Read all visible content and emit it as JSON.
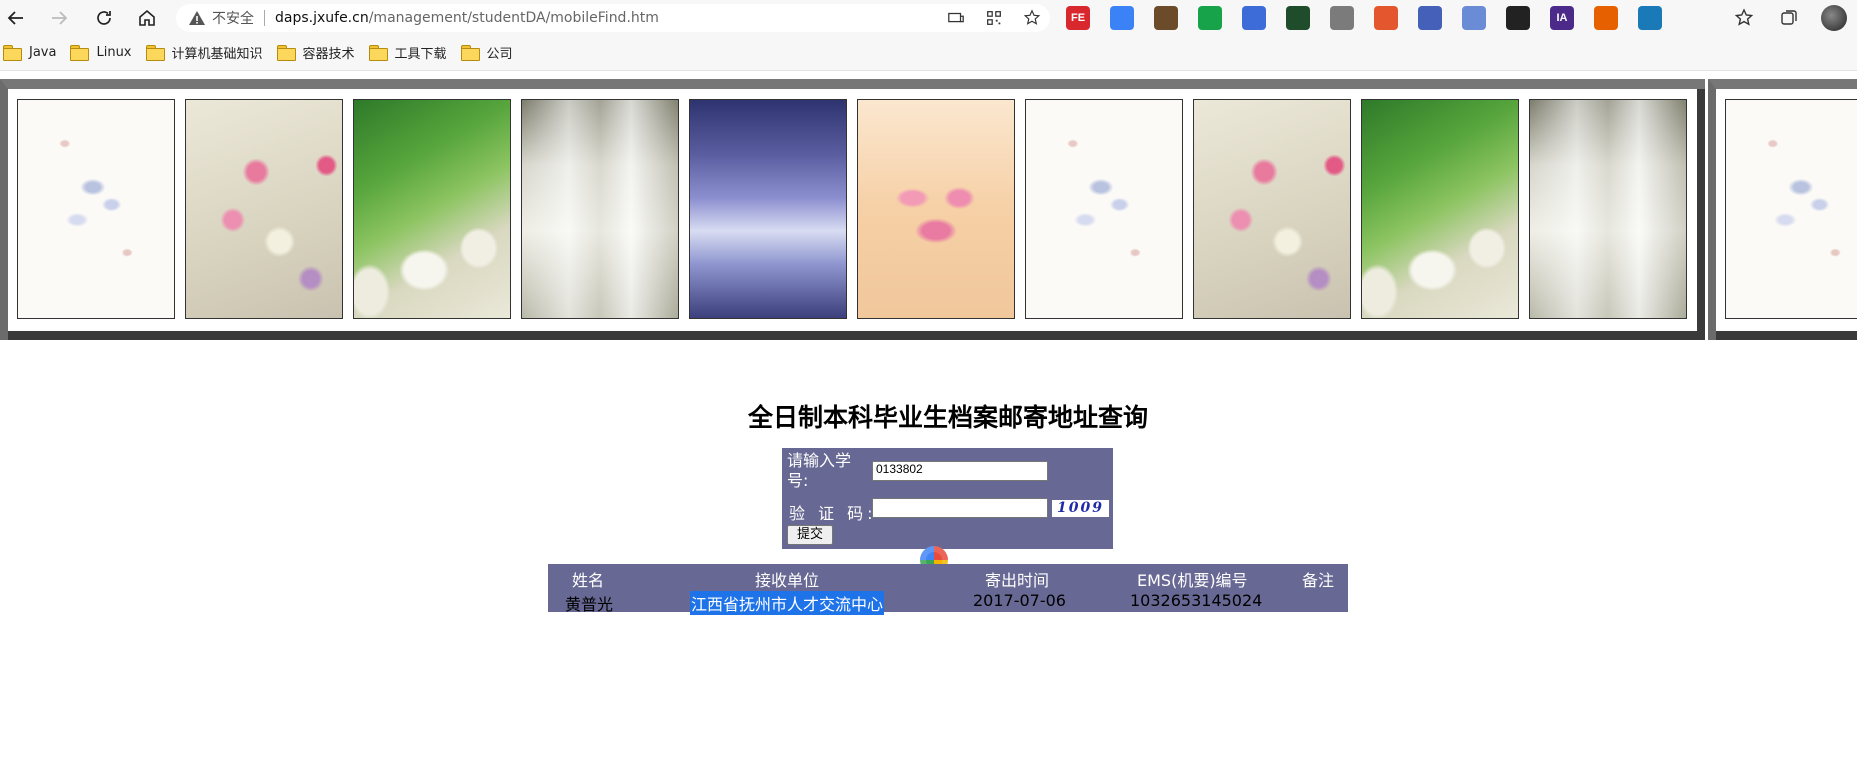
{
  "browser": {
    "security_label": "不安全",
    "url_host": "daps.jxufe.cn",
    "url_path": "/management/studentDA/mobileFind.htm",
    "extensions": [
      {
        "icon": "flag-ext-icon",
        "label": "FE",
        "color": "#d9272e"
      },
      {
        "icon": "bird-ext-icon",
        "label": "",
        "color": "#3b82f6"
      },
      {
        "icon": "books-ext-icon",
        "label": "",
        "color": "#6b4b2a"
      },
      {
        "icon": "shield-ext-icon",
        "label": "",
        "color": "#16a34a"
      },
      {
        "icon": "compass-ext-icon",
        "label": "",
        "color": "#3d6bd8"
      },
      {
        "icon": "code-ext-icon",
        "label": "",
        "color": "#1f4d2c"
      },
      {
        "icon": "vuejs-ext-icon",
        "label": "",
        "color": "#7b7b7b"
      },
      {
        "icon": "tree-ext-icon",
        "label": "",
        "color": "#e4572e"
      },
      {
        "icon": "calendar-ext-icon",
        "label": "",
        "color": "#4460b8"
      },
      {
        "icon": "globe-ext-icon",
        "label": "",
        "color": "#6a8cd6"
      },
      {
        "icon": "cube-ext-icon",
        "label": "",
        "color": "#222222"
      },
      {
        "icon": "ia-ext-icon",
        "label": "IA",
        "color": "#4c2a8a"
      },
      {
        "icon": "firefox-ext-icon",
        "label": "",
        "color": "#e66000"
      },
      {
        "icon": "translate-ext-icon",
        "label": "",
        "color": "#1a7ab8"
      }
    ],
    "bookmarks": [
      "Java",
      "Linux",
      "计算机基础知识",
      "容器技术",
      "工具下载",
      "公司"
    ]
  },
  "page": {
    "title": "全日制本科毕业生档案邮寄地址查询",
    "form": {
      "student_id_label": "请输入学号:",
      "student_id_value": "0133802",
      "captcha_label": "验 证 码:",
      "captcha_value": "",
      "captcha_code": "1009",
      "submit_label": "提交"
    },
    "result": {
      "headers": [
        "姓名",
        "接收单位",
        "寄出时间",
        "EMS(机要)编号",
        "备注"
      ],
      "rows": [
        [
          "黄普光",
          "江西省抚州市人才交流中心",
          "2017-07-06",
          "1032653145024",
          ""
        ]
      ]
    }
  }
}
